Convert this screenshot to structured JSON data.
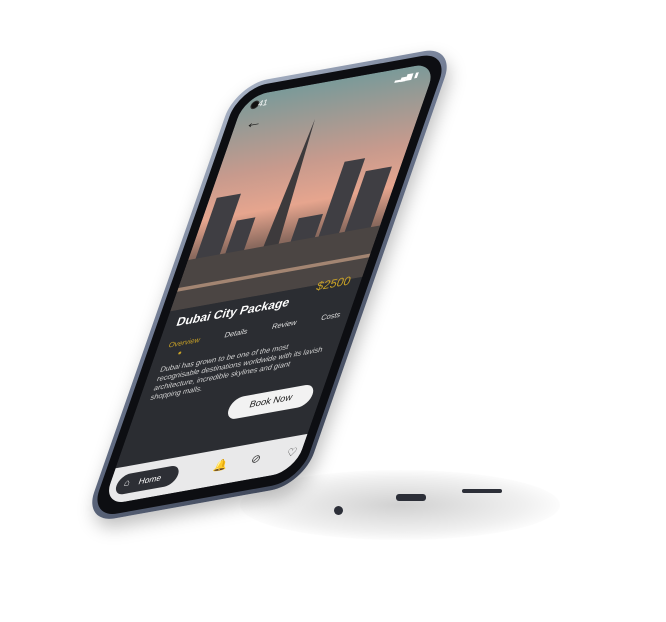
{
  "status": {
    "time": "41",
    "icons": "▂▄▆ ▮"
  },
  "nav": {
    "back_icon": "←"
  },
  "package": {
    "title": "Dubai City Package",
    "price": "$2500"
  },
  "tabs": [
    {
      "label": "Overview",
      "active": true
    },
    {
      "label": "Details",
      "active": false
    },
    {
      "label": "Review",
      "active": false
    },
    {
      "label": "Costs",
      "active": false
    }
  ],
  "description": "Dubai has grown to be one of the most recognisable destinations worldwide with its lavish architecture, incredible skylines and giant shopping malls.",
  "book_button": {
    "label": "Book Now"
  },
  "bottom_nav": {
    "home_label": "Home",
    "home_icon": "⌂",
    "bell_icon": "🔔",
    "compass_icon": "⊘",
    "heart_icon": "♡"
  },
  "colors": {
    "accent": "#c9a227",
    "panel": "#2b2d32",
    "navbar": "#e9e9ea"
  }
}
